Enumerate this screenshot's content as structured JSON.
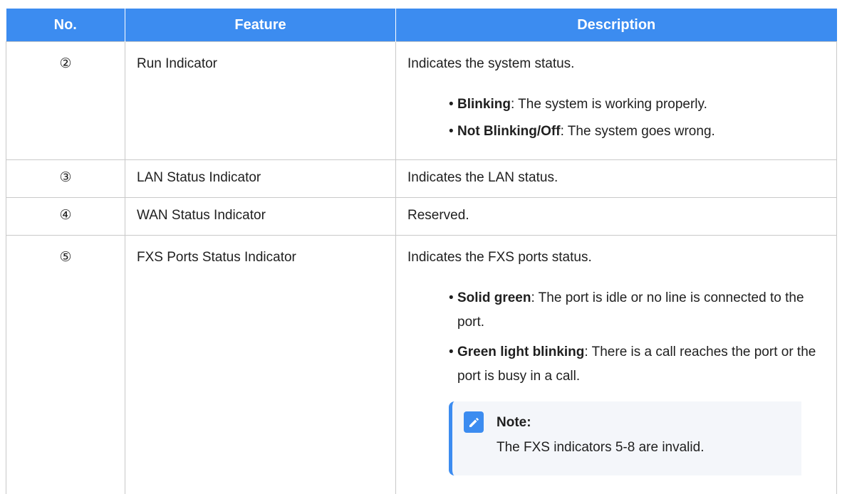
{
  "table": {
    "headers": [
      "No.",
      "Feature",
      "Description"
    ],
    "rows": [
      {
        "no": "②",
        "feature": "Run Indicator",
        "description": "Indicates the system status.",
        "bullets": [
          {
            "term": "Blinking",
            "text": ": The system is working properly."
          },
          {
            "term": "Not Blinking/Off",
            "text": ": The system goes wrong."
          }
        ]
      },
      {
        "no": "③",
        "feature": "LAN Status Indicator",
        "description": "Indicates the LAN status."
      },
      {
        "no": "④",
        "feature": "WAN Status Indicator",
        "description": "Reserved."
      },
      {
        "no": "⑤",
        "feature": "FXS Ports Status Indicator",
        "description": "Indicates the FXS ports status.",
        "bullets": [
          {
            "term": "Solid green",
            "text": ": The port is idle or no line is connected to the port."
          },
          {
            "term": "Green light blinking",
            "text": ": There is a call reaches the port or the port is busy in a call."
          }
        ],
        "note": {
          "icon": "edit-note-icon",
          "title": "Note:",
          "text": "The FXS indicators 5-8 are invalid."
        }
      }
    ]
  },
  "colors": {
    "header_bg": "#3c8cf0",
    "accent": "#3c8cf0",
    "border": "#c9c9c9",
    "note_bg": "#f4f6fa"
  }
}
